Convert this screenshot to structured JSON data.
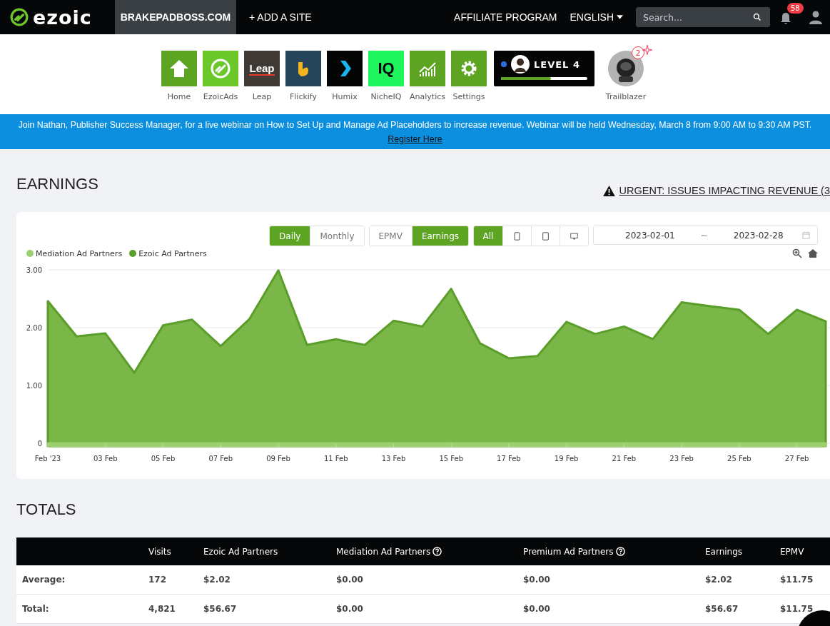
{
  "topbar": {
    "logo": "ezoic",
    "site": "BRAKEPADBOSS.COM",
    "add_site": "+ ADD A SITE",
    "affiliate": "AFFILIATE PROGRAM",
    "language": "ENGLISH",
    "search": {
      "placeholder": "Search..."
    },
    "notifications": "58"
  },
  "apps": [
    {
      "label": "Home",
      "kind": "home"
    },
    {
      "label": "EzoicAds",
      "kind": "ezoicads"
    },
    {
      "label": "Leap",
      "kind": "leap",
      "mark": "Leap"
    },
    {
      "label": "Flickify",
      "kind": "flickify"
    },
    {
      "label": "Humix",
      "kind": "humix"
    },
    {
      "label": "NicheIQ",
      "kind": "nicheiq",
      "mark": "IQ"
    },
    {
      "label": "Analytics",
      "kind": "analytics"
    },
    {
      "label": "Settings",
      "kind": "settings"
    }
  ],
  "level_card": {
    "label": "LEVEL 4",
    "level": 0.58
  },
  "trailblazer": {
    "label": "Trailblazer",
    "badge": "2"
  },
  "banner": {
    "text": "Join Nathan, Publisher Success Manager, for a live webinar on How to Set Up and Manage Ad Placeholders to increase revenue. Webinar will be held Wednesday, March 8 from 9:00 AM to 9:30 AM PST.",
    "link": "Register Here"
  },
  "earnings": {
    "title": "EARNINGS",
    "urgent": "URGENT: ISSUES IMPACTING REVENUE (3",
    "period": [
      {
        "label": "Daily",
        "selected": true
      },
      {
        "label": "Monthly",
        "selected": false
      }
    ],
    "metric": [
      {
        "label": "EPMV",
        "selected": false
      },
      {
        "label": "Earnings",
        "selected": true
      }
    ],
    "devices": [
      {
        "kind": "all",
        "label": "All",
        "selected": true
      },
      {
        "kind": "tablet",
        "selected": false
      },
      {
        "kind": "phone",
        "selected": false
      },
      {
        "kind": "desktop",
        "selected": false
      }
    ],
    "date_range": {
      "start": "2023-02-01",
      "separator": "~",
      "end": "2023-02-28"
    },
    "chart_data": {
      "type": "area",
      "categories": [
        "Feb '23",
        null,
        "03 Feb",
        null,
        "05 Feb",
        null,
        "07 Feb",
        null,
        "09 Feb",
        null,
        "11 Feb",
        null,
        "13 Feb",
        null,
        "15 Feb",
        null,
        "17 Feb",
        null,
        "19 Feb",
        null,
        "21 Feb",
        null,
        "23 Feb",
        null,
        "25 Feb",
        null,
        "27 Feb",
        null
      ],
      "series": [
        {
          "name": "Mediation Ad Partners",
          "color": "#9ccf6f",
          "values": [
            0,
            0,
            0,
            0,
            0,
            0,
            0,
            0,
            0,
            0,
            0,
            0,
            0,
            0,
            0,
            0,
            0,
            0,
            0,
            0,
            0,
            0,
            0,
            0,
            0,
            0,
            0,
            0
          ]
        },
        {
          "name": "Ezoic Ad Partners",
          "color": "#5a9e2a",
          "values": [
            2.46,
            1.85,
            1.9,
            1.22,
            2.04,
            2.14,
            1.68,
            2.15,
            2.99,
            1.7,
            1.8,
            1.7,
            2.12,
            2.02,
            2.67,
            1.73,
            1.47,
            1.51,
            2.1,
            1.89,
            2.02,
            1.8,
            2.44,
            2.37,
            2.31,
            1.89,
            2.31,
            2.11
          ]
        }
      ],
      "ylim": [
        0,
        3
      ],
      "yticks": [
        0,
        {
          "value": 1,
          "label": "1.00"
        },
        {
          "value": 2,
          "label": "2.00"
        },
        {
          "value": 3,
          "label": "3.00"
        }
      ]
    }
  },
  "totals": {
    "title": "TOTALS",
    "columns": [
      {
        "label": "Visits"
      },
      {
        "label": "Ezoic Ad Partners"
      },
      {
        "label": "Mediation Ad Partners",
        "help": true
      },
      {
        "label": "Premium Ad Partners",
        "help": true
      },
      {
        "label": "Earnings"
      },
      {
        "label": "EPMV"
      }
    ],
    "rows": [
      {
        "label": "Average:",
        "cells": [
          "172",
          "$2.02",
          "$0.00",
          "$0.00",
          "$2.02",
          "$11.75"
        ]
      },
      {
        "label": "Total:",
        "cells": [
          "4,821",
          "$56.67",
          "$0.00",
          "$0.00",
          "$56.67",
          "$11.75"
        ]
      }
    ]
  }
}
